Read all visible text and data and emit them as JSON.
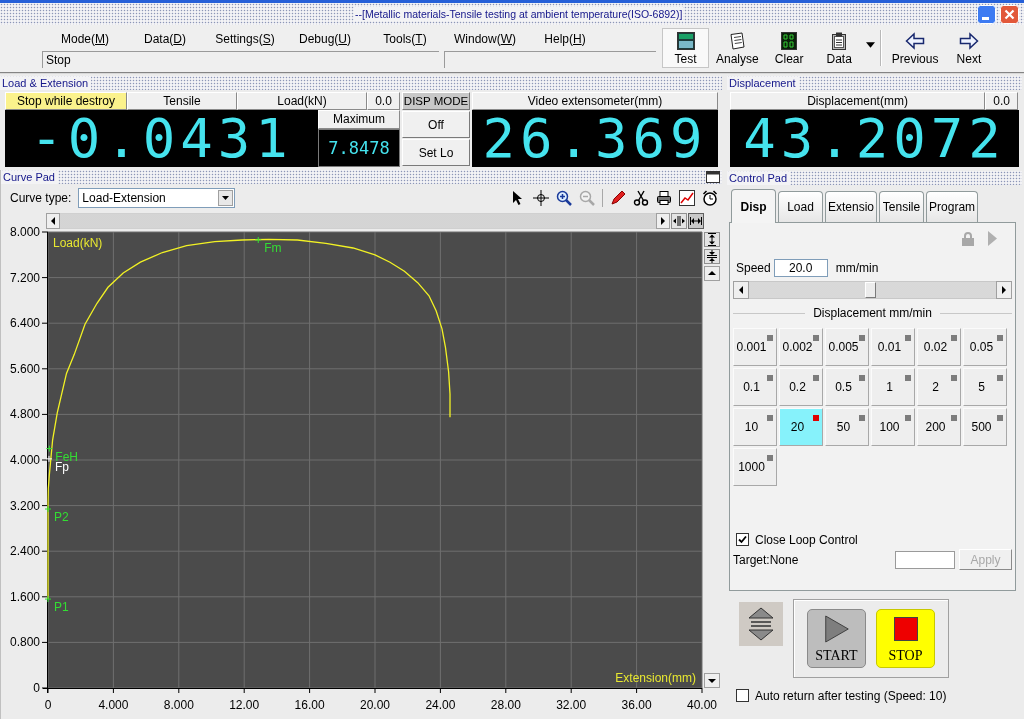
{
  "window": {
    "title": "--[Metallic materials-Tensile testing at ambient temperature(ISO-6892)]"
  },
  "menu": [
    {
      "text_before": "Mode(",
      "accelerator": "M",
      "text_after": ")"
    },
    {
      "text_before": "Data(",
      "accelerator": "D",
      "text_after": ")"
    },
    {
      "text_before": "Settings(",
      "accelerator": "S",
      "text_after": ")"
    },
    {
      "text_before": "Debug(",
      "accelerator": "U",
      "text_after": ")"
    },
    {
      "text_before": "Tools(",
      "accelerator": "T",
      "text_after": ")"
    },
    {
      "text_before": "Window(",
      "accelerator": "W",
      "text_after": ")"
    },
    {
      "text_before": "Help(",
      "accelerator": "H",
      "text_after": ")"
    }
  ],
  "status_bar": {
    "text": "Stop"
  },
  "toolbar": {
    "groups": [
      {
        "items": [
          {
            "kind": "test",
            "label": "Test",
            "selected": true,
            "dropdown": false
          },
          {
            "kind": "analyse",
            "label": "Analyse",
            "selected": false,
            "dropdown": false
          },
          {
            "kind": "clear",
            "label": "Clear",
            "selected": false,
            "dropdown": false
          },
          {
            "kind": "data",
            "label": "Data",
            "selected": false,
            "dropdown": true
          }
        ]
      },
      {
        "items": [
          {
            "kind": "previous",
            "label": "Previous",
            "selected": false,
            "dropdown": false
          },
          {
            "kind": "next",
            "label": "Next",
            "selected": false,
            "dropdown": false
          }
        ]
      }
    ]
  },
  "load_extension": {
    "title": "Load & Extension",
    "header_cells": [
      {
        "text": "Stop while destroy",
        "highlighted": true
      },
      {
        "text": "Tensile",
        "highlighted": false
      },
      {
        "text": "Load(kN)",
        "highlighted": false
      },
      {
        "text": "0.0",
        "highlighted": false
      }
    ],
    "load_reading": "-0.0431",
    "maximum": {
      "label": "Maximum",
      "value": "7.8478"
    },
    "disp_mode": {
      "label": "DISP MODE",
      "buttons": [
        "Off",
        "Set Lo"
      ]
    },
    "extensometer": {
      "label": "Video extensometer(mm)",
      "reading": "26.369"
    }
  },
  "displacement": {
    "title": "Displacement",
    "label": "Displacement(mm)",
    "zero": "0.0",
    "reading": "43.2072"
  },
  "curve_pad": {
    "title": "Curve Pad",
    "curve_type_label": "Curve type:",
    "curve_type": "Load-Extension",
    "chart_data": {
      "type": "line",
      "xlabel": "Extension(mm)",
      "ylabel": "Load(kN)",
      "xlim": [
        0,
        40
      ],
      "ylim": [
        0,
        8
      ],
      "grid": true,
      "xticks": [
        0,
        {
          "value": 4,
          "label": "4.000"
        },
        {
          "value": 8,
          "label": "8.000"
        },
        {
          "value": 12,
          "label": "12.00"
        },
        {
          "value": 16,
          "label": "16.00"
        },
        {
          "value": 20,
          "label": "20.00"
        },
        {
          "value": 24,
          "label": "24.00"
        },
        {
          "value": 28,
          "label": "28.00"
        },
        {
          "value": 32,
          "label": "32.00"
        },
        {
          "value": 36,
          "label": "36.00"
        },
        {
          "value": 40,
          "label": "40.00"
        }
      ],
      "yticks": [
        0,
        {
          "value": 0.8,
          "label": "0.800"
        },
        {
          "value": 1.6,
          "label": "1.600"
        },
        {
          "value": 2.4,
          "label": "2.400"
        },
        {
          "value": 3.2,
          "label": "3.200"
        },
        {
          "value": 4,
          "label": "4.000"
        },
        {
          "value": 4.8,
          "label": "4.800"
        },
        {
          "value": 5.6,
          "label": "5.600"
        },
        {
          "value": 6.4,
          "label": "6.400"
        },
        {
          "value": 7.2,
          "label": "7.200"
        },
        {
          "value": 8,
          "label": "8.000"
        }
      ],
      "x": [
        0,
        0,
        0,
        0.02,
        0.08,
        0.28,
        0.57,
        1.13,
        1.6,
        2.26,
        3.0,
        3.67,
        4.6,
        5.65,
        7.0,
        8.48,
        10.2,
        11.87,
        13.5,
        15.26,
        17.0,
        18.66,
        20.0,
        20.92,
        21.8,
        22.61,
        23.3,
        23.74,
        24.1,
        24.31,
        24.5,
        24.59,
        24.59
      ],
      "values": [
        1.56,
        2.5,
        3.2,
        3.5,
        3.73,
        4.35,
        4.83,
        5.52,
        5.85,
        6.38,
        6.75,
        7.03,
        7.28,
        7.47,
        7.64,
        7.76,
        7.83,
        7.86,
        7.87,
        7.86,
        7.8,
        7.72,
        7.6,
        7.47,
        7.31,
        7.11,
        6.88,
        6.62,
        6.3,
        5.97,
        5.55,
        5.16,
        4.75
      ],
      "annotations": [
        {
          "x": 12.86,
          "y": 7.86,
          "text": "Fm"
        },
        {
          "x": 0.08,
          "y": 4.2,
          "text": "FeH"
        },
        {
          "x": 0.06,
          "y": 4.02,
          "text": "Fp"
        },
        {
          "x": 0,
          "y": 3.14,
          "text": "P2"
        },
        {
          "x": 0,
          "y": 1.56,
          "text": "P1"
        }
      ]
    },
    "markers": [
      {
        "color": "#33dd33"
      },
      {
        "color": "#33dd33"
      },
      {
        "color": "#ffffff"
      },
      {
        "color": "#33dd33"
      },
      {
        "color": "#33dd33"
      }
    ]
  },
  "control_pad": {
    "title": "Control Pad",
    "tabs": [
      {
        "label": "Disp",
        "selected": true
      },
      {
        "label": "Load",
        "selected": false
      },
      {
        "label": "Extensio",
        "selected": false
      },
      {
        "label": "Tensile",
        "selected": false
      },
      {
        "label": "Program",
        "selected": false
      }
    ],
    "speed": {
      "label": "Speed",
      "value": "20.0",
      "unit": "mm/min"
    },
    "slider": {
      "level": 0.49
    },
    "presets_title": "Displacement mm/min",
    "presets": [
      {
        "label": "0.001",
        "selected": false
      },
      {
        "label": "0.002",
        "selected": false
      },
      {
        "label": "0.005",
        "selected": false
      },
      {
        "label": "0.01",
        "selected": false
      },
      {
        "label": "0.02",
        "selected": false
      },
      {
        "label": "0.05",
        "selected": false
      },
      {
        "label": "0.1",
        "selected": false
      },
      {
        "label": "0.2",
        "selected": false
      },
      {
        "label": "0.5",
        "selected": false
      },
      {
        "label": "1",
        "selected": false
      },
      {
        "label": "2",
        "selected": false
      },
      {
        "label": "5",
        "selected": false
      },
      {
        "label": "10",
        "selected": false
      },
      {
        "label": "20",
        "selected": true
      },
      {
        "label": "50",
        "selected": false
      },
      {
        "label": "100",
        "selected": false
      },
      {
        "label": "200",
        "selected": false
      },
      {
        "label": "500",
        "selected": false
      },
      {
        "label": "1000",
        "selected": false
      }
    ],
    "close_loop": {
      "label": "Close Loop Control",
      "checked": true
    },
    "target": {
      "label": "Target:None"
    },
    "apply": {
      "label": "Apply",
      "disabled": true
    },
    "start": {
      "label": "START"
    },
    "stop": {
      "label": "STOP"
    },
    "auto_return": {
      "label": "Auto return after testing (Speed: 10)",
      "checked": false
    }
  }
}
